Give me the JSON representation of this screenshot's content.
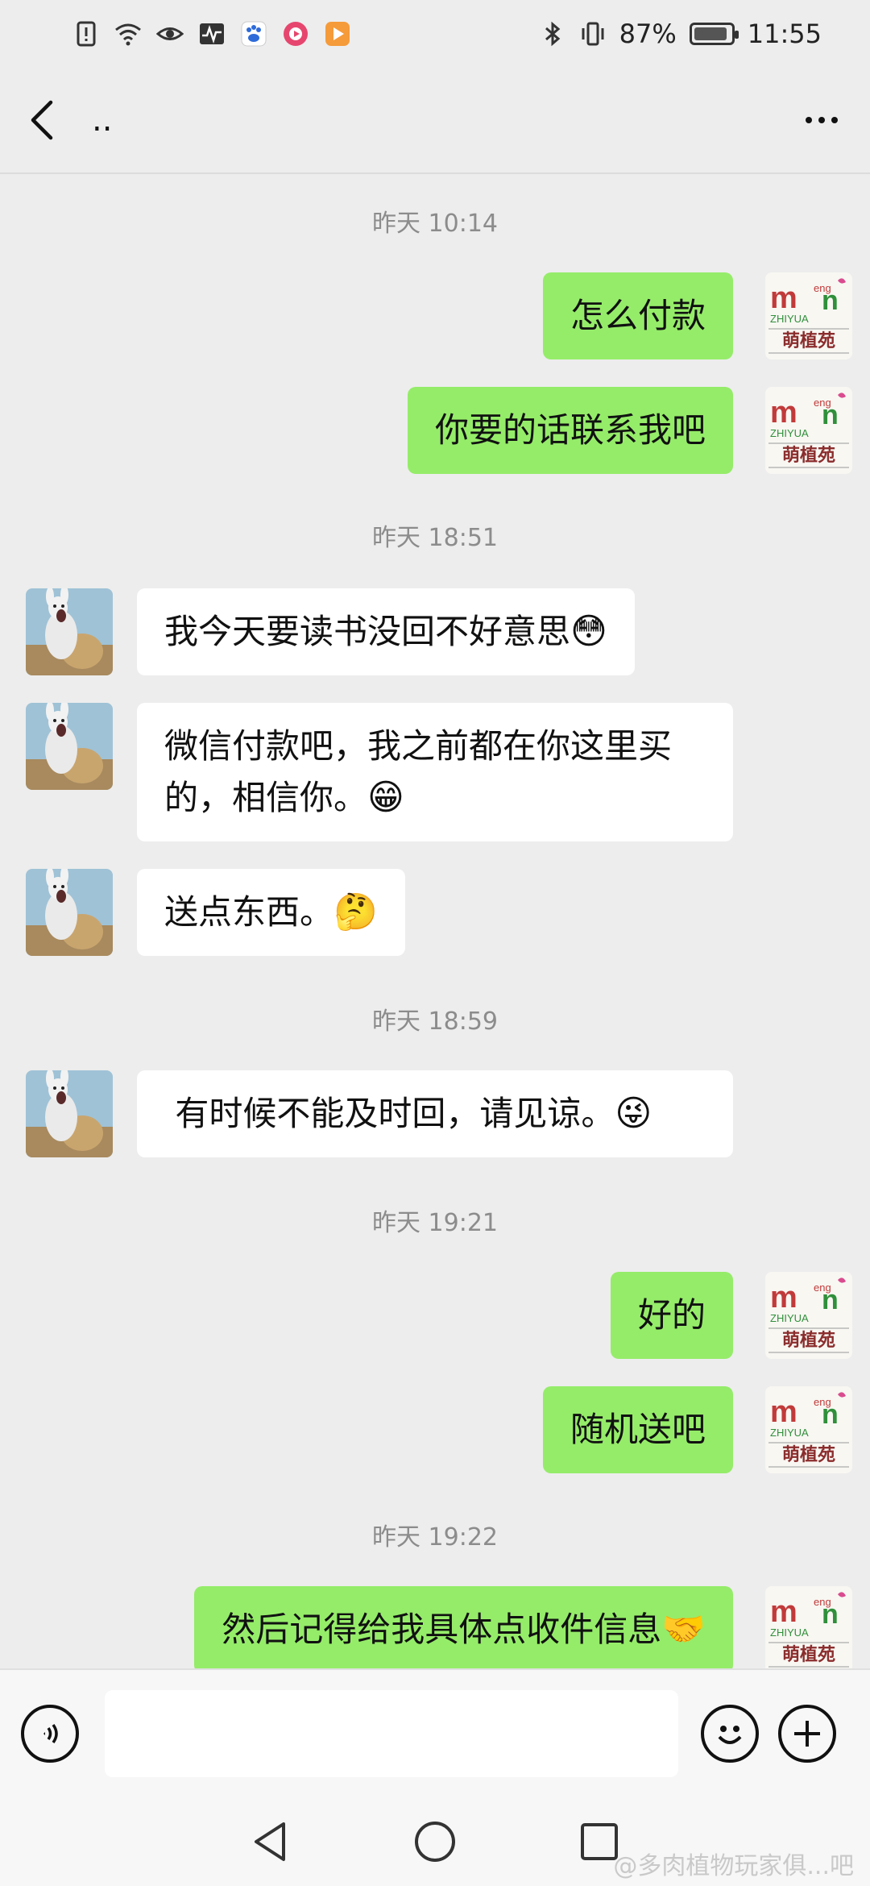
{
  "status_bar": {
    "left_icons": [
      "alert-icon",
      "wifi-icon",
      "eye-icon",
      "activity-icon",
      "paw-icon",
      "music-app-icon",
      "video-app-icon"
    ],
    "battery": "87%",
    "time": "11:55"
  },
  "header": {
    "title": ".."
  },
  "messages": [
    {
      "type": "time",
      "text": "昨天 10:14"
    },
    {
      "type": "sent",
      "text": "怎么付款"
    },
    {
      "type": "sent",
      "text": "你要的话联系我吧"
    },
    {
      "type": "time",
      "text": "昨天 18:51"
    },
    {
      "type": "recv",
      "text": "我今天要读书没回不好意思",
      "emoji": "😳"
    },
    {
      "type": "recv",
      "text": "微信付款吧，我之前都在你这里买的，相信你。",
      "emoji": "😁"
    },
    {
      "type": "recv",
      "text": "送点东西。",
      "emoji": "🤔"
    },
    {
      "type": "time",
      "text": "昨天 18:59"
    },
    {
      "type": "recv",
      "text": " 有时候不能及时回，请见谅。",
      "emoji": "😜"
    },
    {
      "type": "time",
      "text": "昨天 19:21"
    },
    {
      "type": "sent",
      "text": "好的"
    },
    {
      "type": "sent",
      "text": "随机送吧"
    },
    {
      "type": "time",
      "text": "昨天 19:22"
    },
    {
      "type": "sent",
      "text": "然后记得给我具体点收件信息",
      "emoji": "🤝"
    }
  ],
  "avatar_logo": {
    "line1": "m",
    "line1b": "n",
    "small": "eng",
    "line2": "ZHIYUA",
    "name": "萌植苑"
  },
  "input": {
    "placeholder": ""
  },
  "watermark": "@多肉植物玩家俱...吧",
  "colors": {
    "sent_bubble": "#95ec69",
    "recv_bubble": "#ffffff",
    "background": "#ededed"
  }
}
